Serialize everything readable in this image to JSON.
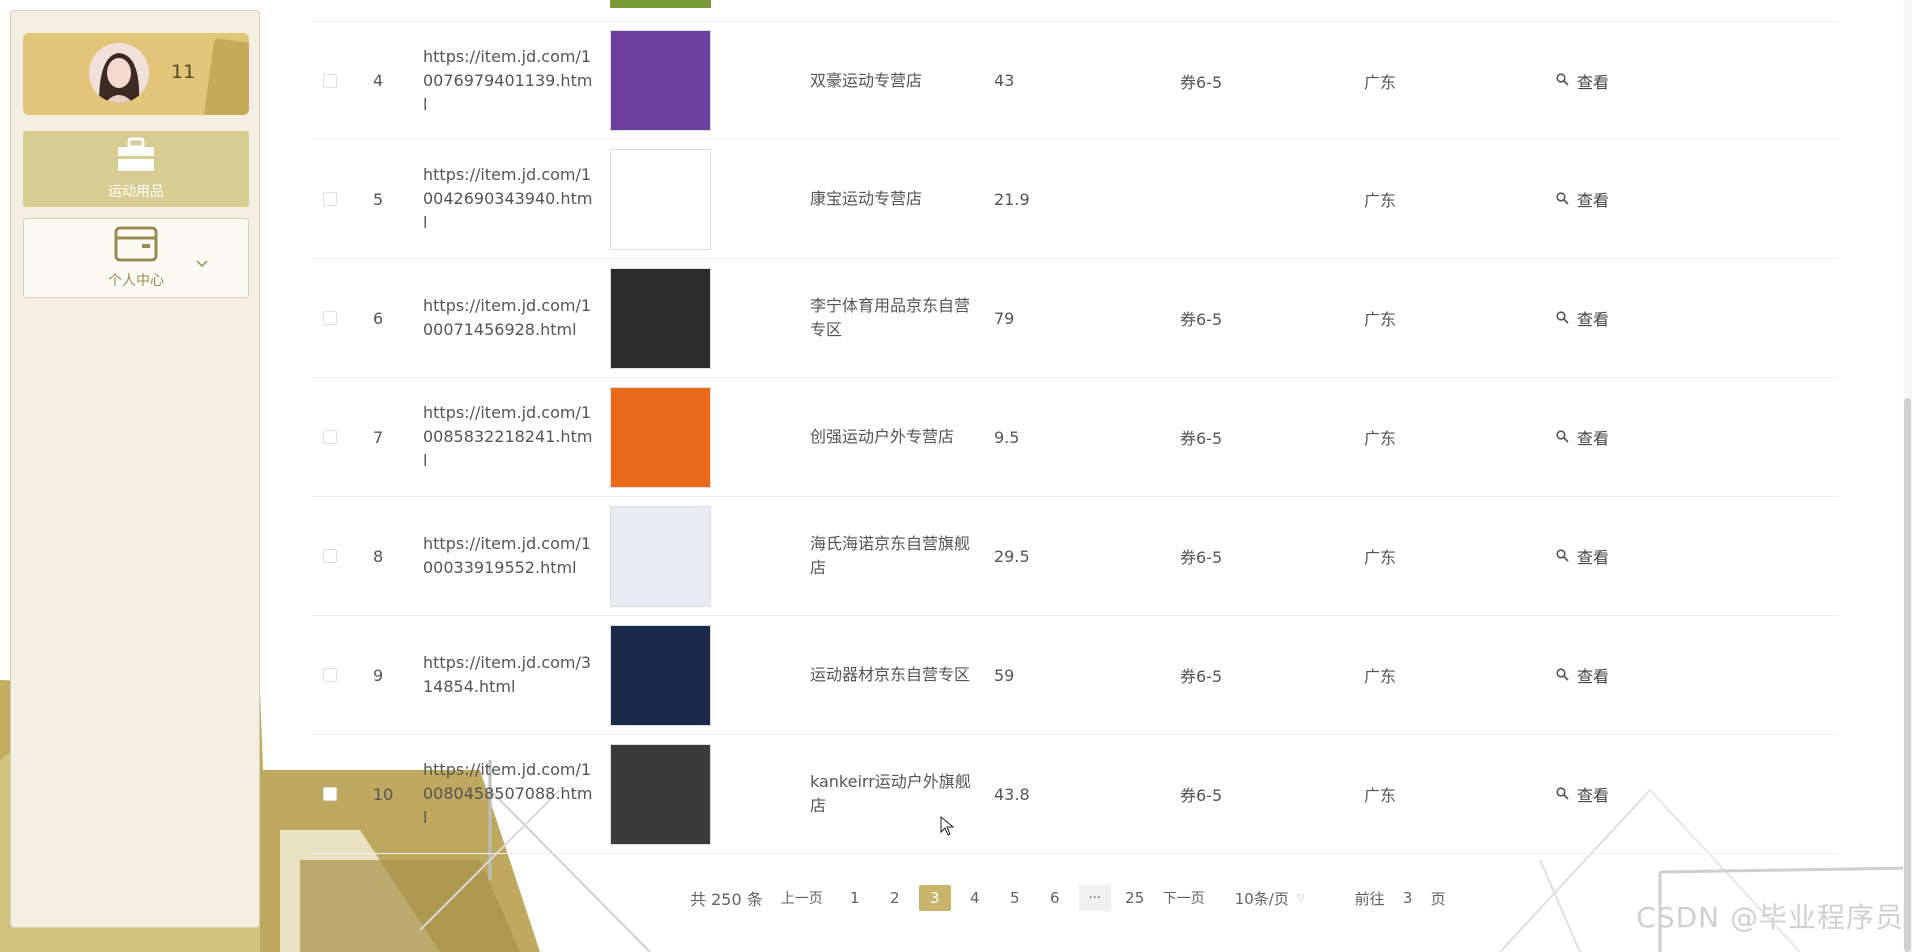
{
  "sidebar": {
    "user": {
      "name": "11"
    },
    "menu": [
      {
        "label": "运动用品",
        "icon": "briefcase-icon"
      },
      {
        "label": "个人中心",
        "icon": "wallet-icon"
      }
    ]
  },
  "table": {
    "view_label": "查看",
    "rows": [
      {
        "index": "4",
        "url": "https://item.jd.com/10076979401139.html",
        "shop": "双豪运动专营店",
        "price": "43",
        "coupon": "券6-5",
        "region": "广东",
        "thumb_color": "#6a3fa0"
      },
      {
        "index": "5",
        "url": "https://item.jd.com/10042690343940.html",
        "shop": "康宝运动专营店",
        "price": "21.9",
        "coupon": "",
        "region": "广东",
        "thumb_color": "#ffffff"
      },
      {
        "index": "6",
        "url": "https://item.jd.com/100071456928.html",
        "shop": "李宁体育用品京东自营专区",
        "price": "79",
        "coupon": "券6-5",
        "region": "广东",
        "thumb_color": "#2b2b2b"
      },
      {
        "index": "7",
        "url": "https://item.jd.com/10085832218241.html",
        "shop": "创强运动户外专营店",
        "price": "9.5",
        "coupon": "券6-5",
        "region": "广东",
        "thumb_color": "#e86a1a"
      },
      {
        "index": "8",
        "url": "https://item.jd.com/100033919552.html",
        "shop": "海氏海诺京东自营旗舰店",
        "price": "29.5",
        "coupon": "券6-5",
        "region": "广东",
        "thumb_color": "#e8ecf2"
      },
      {
        "index": "9",
        "url": "https://item.jd.com/314854.html",
        "shop": "运动器材京东自营专区",
        "price": "59",
        "coupon": "券6-5",
        "region": "广东",
        "thumb_color": "#1a2a4a"
      },
      {
        "index": "10",
        "url": "https://item.jd.com/10080458507088.html",
        "shop": "kankeirr运动户外旗舰店",
        "price": "43.8",
        "coupon": "券6-5",
        "region": "广东",
        "thumb_color": "#3a3a3a"
      }
    ]
  },
  "pagination": {
    "total": "共 250 条",
    "prev": "上一页",
    "pages": [
      "1",
      "2",
      "3",
      "4",
      "5",
      "6"
    ],
    "active_page": "3",
    "more": "···",
    "last": "25",
    "next": "下一页",
    "page_size": "10条/页",
    "goto_prefix": "前往",
    "goto_value": "3",
    "goto_suffix": "页"
  },
  "watermark": "CSDN @毕业程序员",
  "colors": {
    "accent": "#c8b46a",
    "sidebar_bg": "#f3efe2",
    "user_card": "#e2c57a",
    "menu_active": "#d9cc92",
    "deco_gold": "#c0ad5e"
  }
}
